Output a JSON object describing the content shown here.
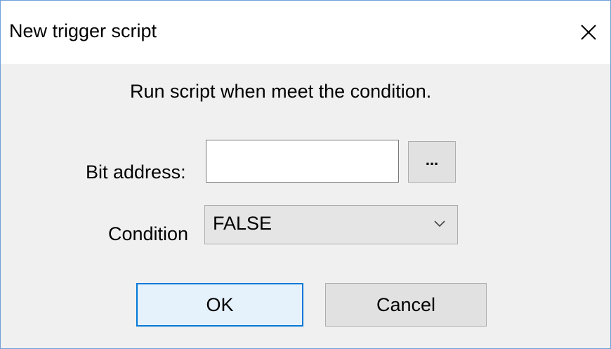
{
  "window": {
    "title": "New trigger script",
    "close_icon": "close-icon"
  },
  "dialog": {
    "message": "Run script when meet the condition.",
    "bit_address": {
      "label": "Bit address:",
      "value": "",
      "browse_label": "..."
    },
    "condition": {
      "label": "Condition",
      "selected": "FALSE",
      "arrow_icon": "chevron-down-icon"
    },
    "buttons": {
      "ok": "OK",
      "cancel": "Cancel"
    }
  },
  "colors": {
    "focus_border": "#0078d7",
    "dialog_background": "#f0f0f0",
    "window_border": "#6fa0d8"
  }
}
